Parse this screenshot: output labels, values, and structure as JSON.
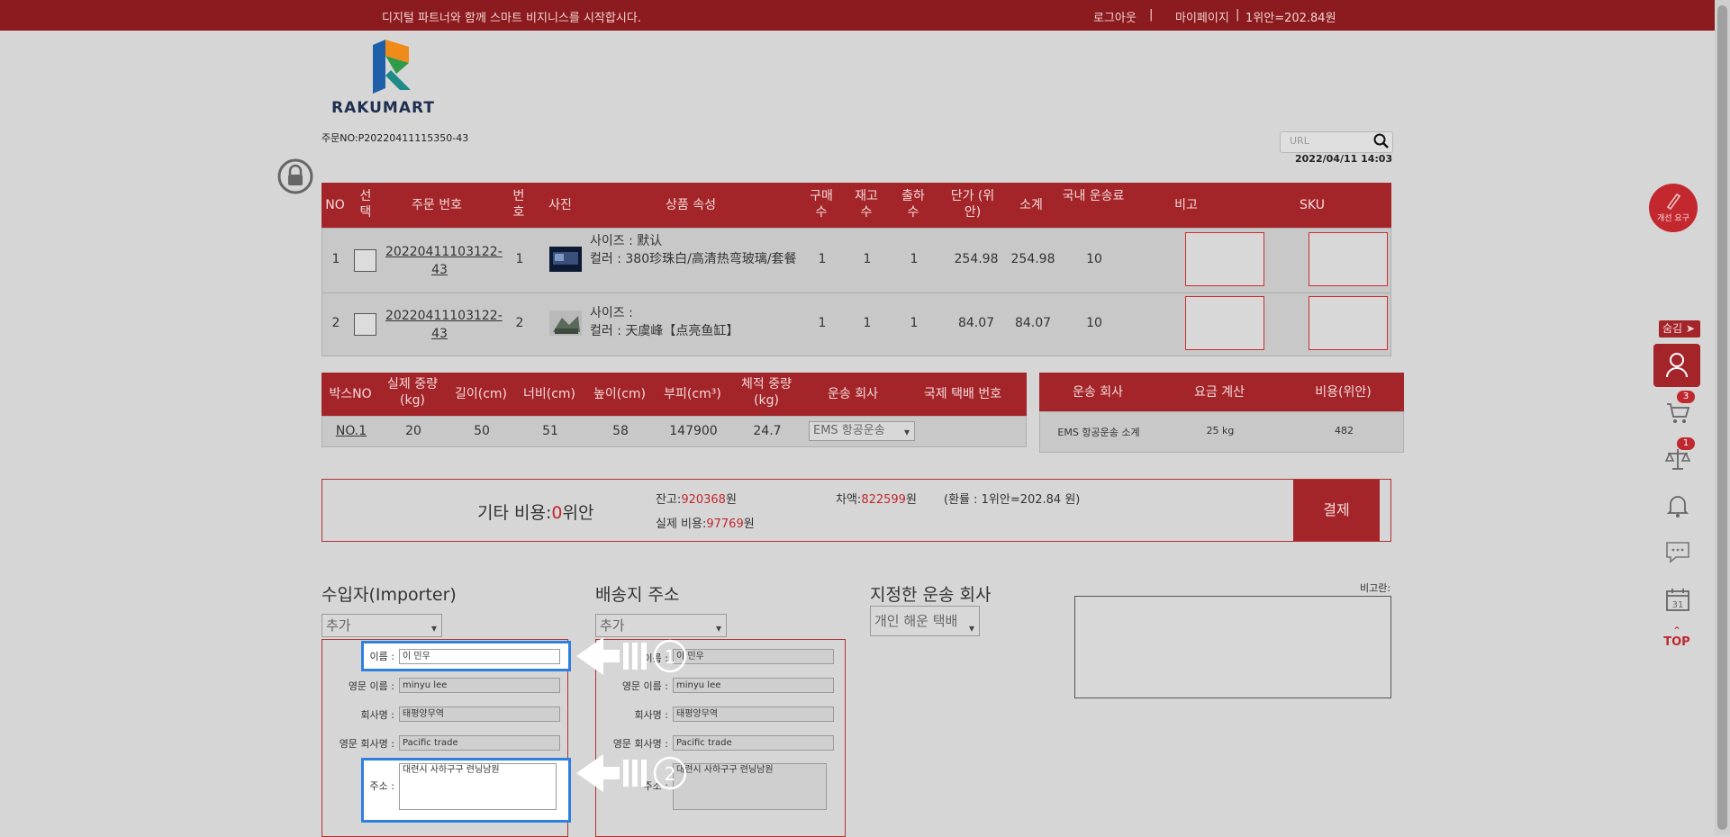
{
  "topbar": {
    "slogan": "디지털 파트너와 함께 스마트 비지니스를 시작합시다.",
    "logout": "로그아웃",
    "sep1": "|",
    "mypage": "마이페이지",
    "sep2": "|",
    "rate": "1위안=202.84원"
  },
  "logo": {
    "text": "RAKUMART"
  },
  "order": {
    "label": "주문NO:P20220411115350-43",
    "datetime": "2022/04/11 14:03"
  },
  "search": {
    "placeholder": "URL"
  },
  "items_table": {
    "headers": [
      "NO",
      "선택",
      "주문 번호",
      "번호",
      "사진",
      "상품 속성",
      "구매수",
      "재고수",
      "출하수",
      "단가 (위안)",
      "소계",
      "국내 운송료",
      "비고",
      "SKU"
    ],
    "rows": [
      {
        "no": "1",
        "order": "20220411103122-43",
        "num": "1",
        "size": "사이즈 : 默认",
        "color": "컬러 : 380珍珠白/高清热弯玻璃/套餐",
        "buy": "1",
        "stock": "1",
        "ship": "1",
        "price": "254.98",
        "subtotal": "254.98",
        "domestic": "10"
      },
      {
        "no": "2",
        "order": "20220411103122-43",
        "num": "2",
        "size": "사이즈 :",
        "color": "컬러 : 天虞峰【点亮鱼缸】",
        "buy": "1",
        "stock": "1",
        "ship": "1",
        "price": "84.07",
        "subtotal": "84.07",
        "domestic": "10"
      }
    ]
  },
  "box_table": {
    "headers": [
      "박스NO",
      "실제 중량(kg)",
      "길이(cm)",
      "너비(cm)",
      "높이(cm)",
      "부피(cm³)",
      "체적 중량(kg)",
      "운송 회사",
      "국제 택배 번호"
    ],
    "row": {
      "box": "NO.1",
      "weight": "20",
      "length": "50",
      "width": "51",
      "height": "58",
      "volume": "147900",
      "vol_weight": "24.7",
      "carrier": "EMS 항공운송"
    }
  },
  "shipping_table": {
    "headers": [
      "운송 회사",
      "요금 계산",
      "비용(위안)"
    ],
    "row": {
      "carrier": "EMS 항공운송 소계",
      "calc": "25  kg",
      "cost": "482"
    }
  },
  "payment": {
    "other_label": "기타 비용:",
    "other_value": "0",
    "other_unit": "위안",
    "balance_label": "잔고:",
    "balance_value": "920368",
    "balance_unit": "원",
    "diff_label": "차액:",
    "diff_value": "822599",
    "diff_unit": "원",
    "rate_note": "(환률 : 1위안=202.84 원)",
    "actual_label": "실제 비용:",
    "actual_value": "97769",
    "actual_unit": "원",
    "pay_button": "결제"
  },
  "importer": {
    "title": "수입자(Importer)",
    "select": "추가",
    "name_label": "이름 :",
    "name": "이 민우",
    "en_name_label": "영문 이름 :",
    "en_name": "minyu lee",
    "company_label": "회사명 :",
    "company": "태평양무역",
    "en_company_label": "영문 회사명 :",
    "en_company": "Pacific trade",
    "address_label": "주소 :",
    "address": "대련시 사하구구 련닝남원"
  },
  "delivery": {
    "title": "배송지 주소",
    "select": "추가",
    "name_label": "이름 :",
    "name": "이 민우",
    "en_name_label": "영문 이름 :",
    "en_name": "minyu lee",
    "company_label": "회사명 :",
    "company": "태평양무역",
    "en_company_label": "영문 회사명 :",
    "en_company": "Pacific trade",
    "address_label": "주소 :",
    "address": "대련시 사하구구 련닝남원"
  },
  "carrier_pick": {
    "title": "지정한 운송 회사",
    "select": "개인 해운 택배"
  },
  "remarks": {
    "label": "비고란:"
  },
  "annotations": {
    "step1": "1",
    "step2": "2"
  },
  "side": {
    "improve": "개선 요구",
    "hide": "숨김",
    "cart_badge": "3",
    "list_badge": "1",
    "calendar_day": "31",
    "top": "TOP"
  },
  "colors": {
    "brand": "#a3252a",
    "accent_text": "#c0282f",
    "highlight": "#2e7fe0"
  }
}
